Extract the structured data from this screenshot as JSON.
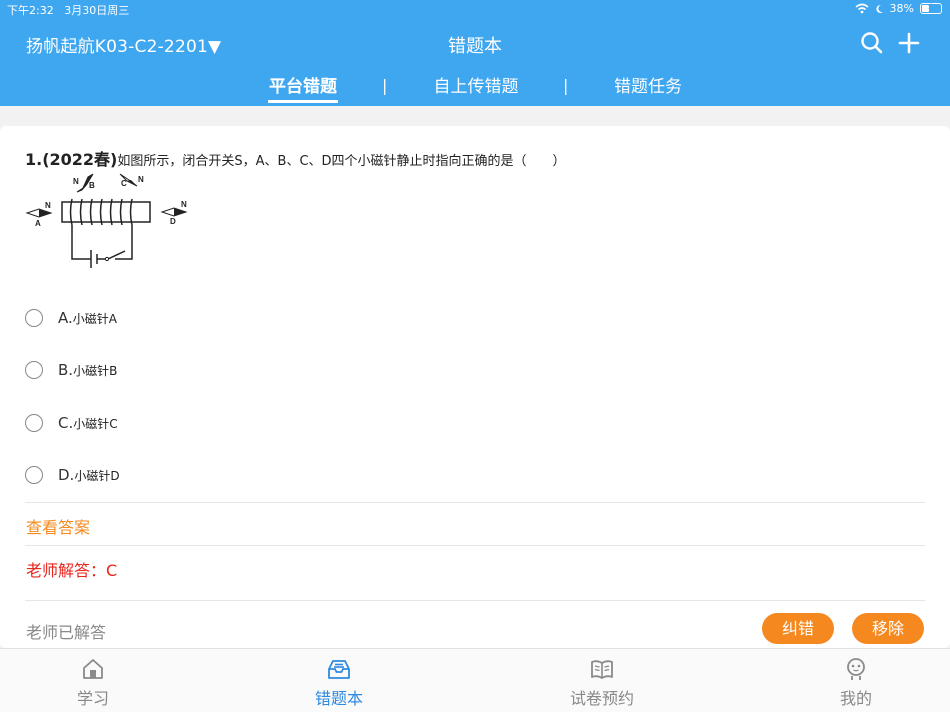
{
  "status_bar": {
    "time": "下午2:32",
    "date": "3月30日周三",
    "battery": "38%",
    "battery_level": 0.38
  },
  "header": {
    "class_select": "扬帆起航K03-C2-2201▼",
    "title": "错题本",
    "search_icon": "search-icon",
    "add_icon": "plus-icon",
    "tabs": [
      {
        "label": "平台错题",
        "active": true
      },
      {
        "label": "自上传错题",
        "active": false
      },
      {
        "label": "错题任务",
        "active": false
      }
    ],
    "separator": "|"
  },
  "question": {
    "number": "1.(2022春)",
    "text": "如图所示，闭合开关S，A、B、C、D四个小磁针静止时指向正确的是（　　）",
    "figure_labels": {
      "n": "N",
      "a": "A",
      "b": "B",
      "c": "C",
      "d": "D"
    },
    "options": [
      {
        "letter": "A.",
        "text": "小磁针A"
      },
      {
        "letter": "B.",
        "text": "小磁针B"
      },
      {
        "letter": "C.",
        "text": "小磁针C"
      },
      {
        "letter": "D.",
        "text": "小磁针D"
      }
    ]
  },
  "answer": {
    "view_answer": "查看答案",
    "teacher_answer": "老师解答：C",
    "status": "老师已解答",
    "correct_button": "纠错",
    "remove_button": "移除"
  },
  "tabbar": [
    {
      "label": "学习",
      "icon": "home-icon",
      "active": false
    },
    {
      "label": "错题本",
      "icon": "inbox-icon",
      "active": true
    },
    {
      "label": "试卷预约",
      "icon": "book-icon",
      "active": false
    },
    {
      "label": "我的",
      "icon": "user-icon",
      "active": false
    }
  ],
  "colors": {
    "header": "#3fa6f0",
    "accent_orange": "#f5881f",
    "answer_red": "#e8261c",
    "tab_active": "#2e8ae0"
  }
}
